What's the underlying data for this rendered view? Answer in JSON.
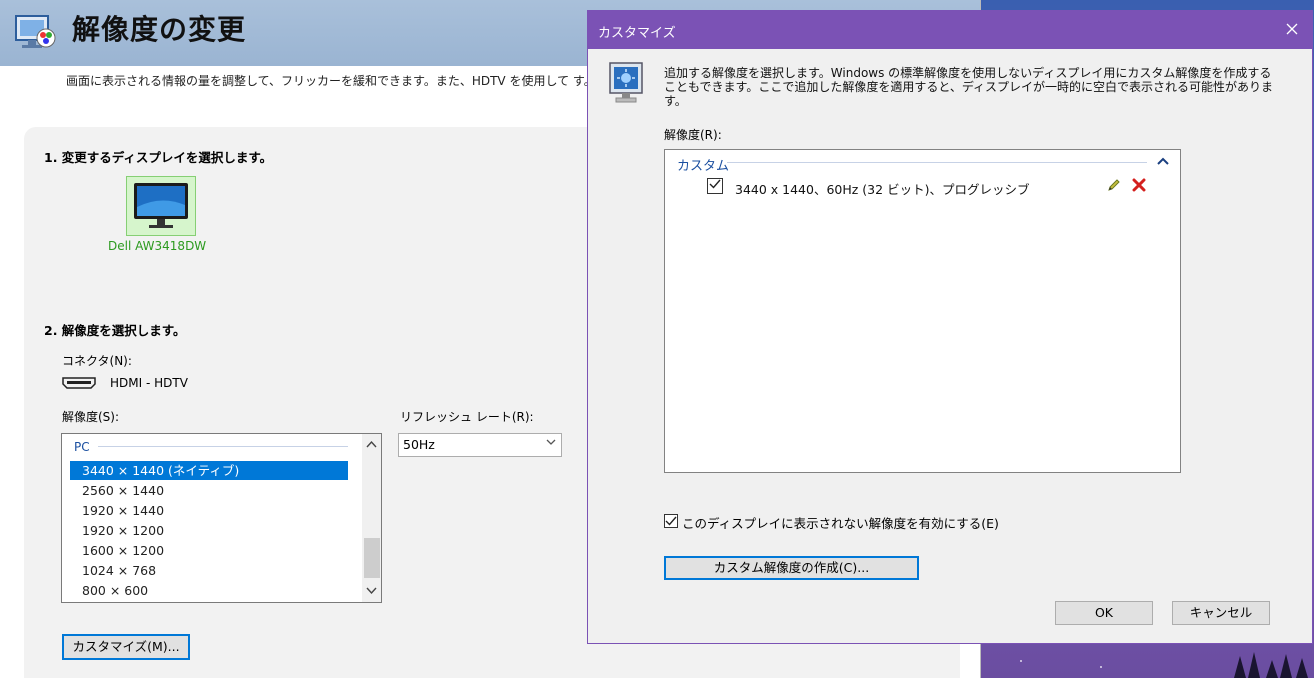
{
  "main": {
    "title": "解像度の変更",
    "description": "画面に表示される情報の量を調整して、フリッカーを緩和できます。また、HDTV を使用して す。",
    "section1_label": "1. 変更するディスプレイを選択します。",
    "display_name": "Dell AW3418DW",
    "section2_label": "2. 解像度を選択します。",
    "connector_label": "コネクタ(N):",
    "connector_value": "HDMI - HDTV",
    "resolution_label": "解像度(S):",
    "refresh_label": "リフレッシュ レート(R):",
    "resolution_group": "PC",
    "resolutions": [
      "3440 × 1440 (ネイティブ)",
      "2560 × 1440",
      "1920 × 1440",
      "1920 × 1200",
      "1600 × 1200",
      "1024 × 768",
      "800 × 600"
    ],
    "selected_resolution_index": 0,
    "refresh_value": "50Hz",
    "customize_button": "カスタマイズ(M)..."
  },
  "dialog": {
    "title": "カスタマイズ",
    "description": "追加する解像度を選択します。Windows の標準解像度を使用しないディスプレイ用にカスタム解像度を作成することもできます。ここで追加した解像度を適用すると、ディスプレイが一時的に空白で表示される可能性があります。",
    "resolution_label": "解像度(R):",
    "group_label": "カスタム",
    "custom_item": "3440 x 1440、60Hz (32 ビット)、プログレッシブ",
    "custom_item_checked": true,
    "enable_label": "このディスプレイに表示されない解像度を有効にする(E)",
    "enable_checked": true,
    "create_button": "カスタム解像度の作成(C)...",
    "ok_button": "OK",
    "cancel_button": "キャンセル"
  },
  "colors": {
    "accent": "#0078d7",
    "dialog_titlebar": "#7b52b5",
    "header_bar": "#9ab4d2",
    "display_green": "#2c9a1f",
    "group_blue": "#1a4fa0"
  },
  "icons": [
    "display-settings-icon",
    "monitor-icon",
    "hdmi-icon",
    "chevron-down-icon",
    "close-icon",
    "monitor-screen-icon",
    "collapse-icon",
    "pencil-icon",
    "delete-x-icon",
    "checkmark-icon"
  ]
}
